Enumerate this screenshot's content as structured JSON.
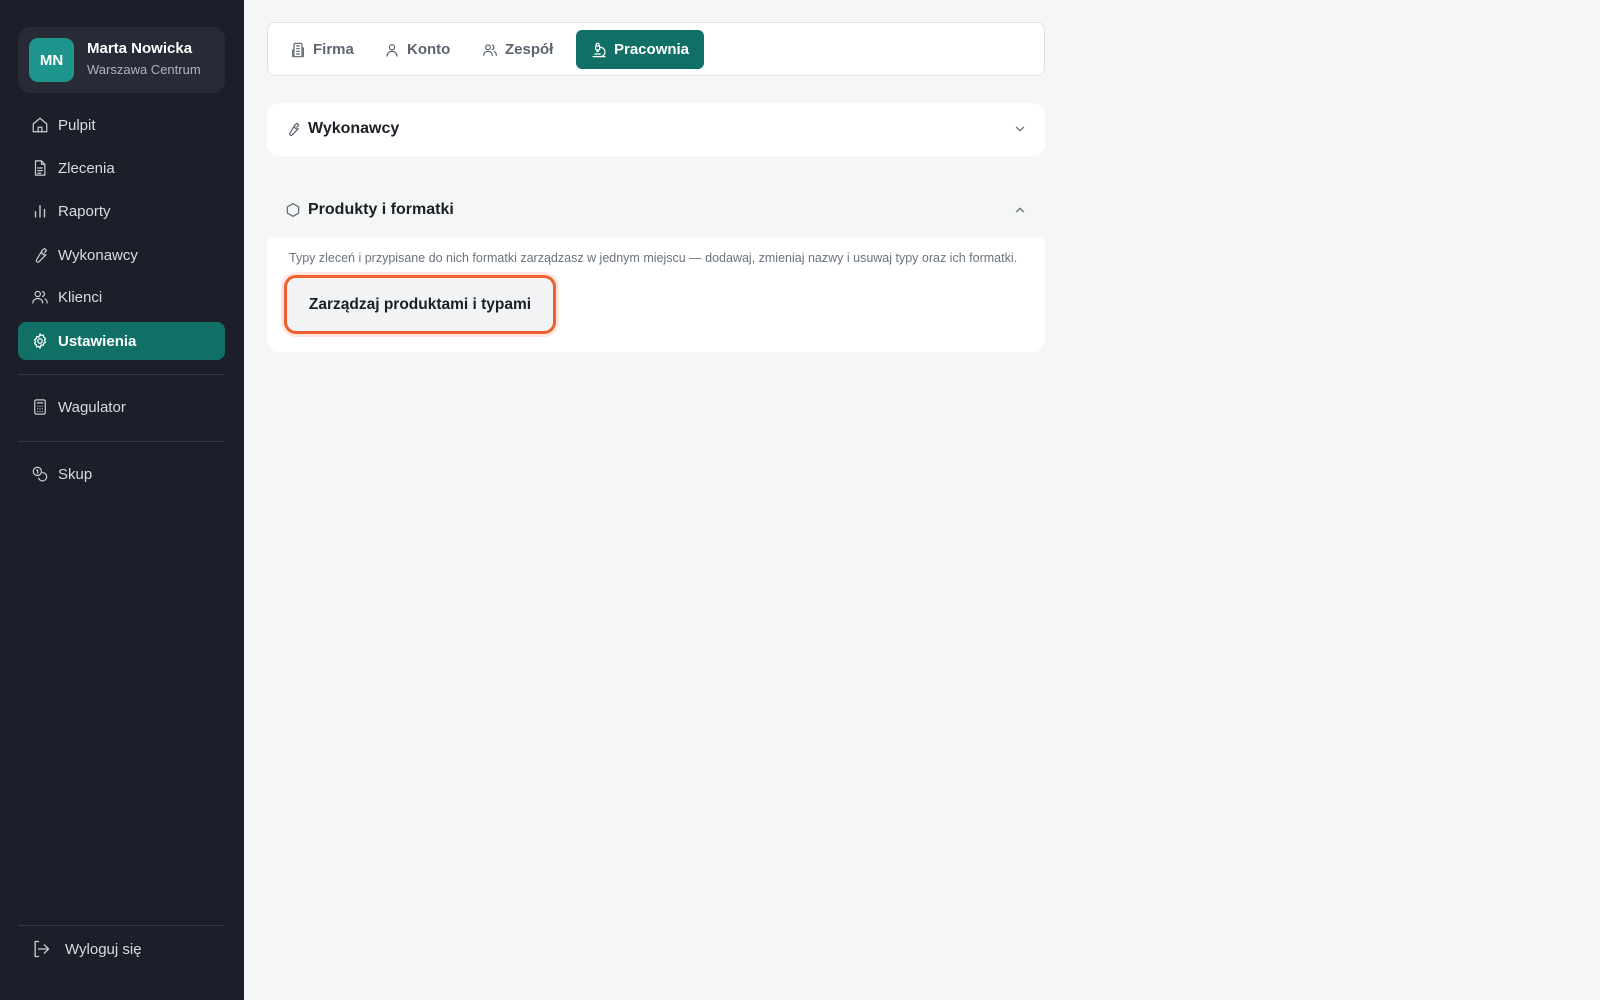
{
  "user": {
    "initials": "MN",
    "name": "Marta Nowicka",
    "branch": "Warszawa Centrum"
  },
  "sidebar": {
    "items": [
      {
        "label": "Pulpit",
        "icon": "home-icon"
      },
      {
        "label": "Zlecenia",
        "icon": "document-icon"
      },
      {
        "label": "Raporty",
        "icon": "bar-chart-icon"
      },
      {
        "label": "Wykonawcy",
        "icon": "wrench-icon"
      },
      {
        "label": "Klienci",
        "icon": "users-icon"
      },
      {
        "label": "Ustawienia",
        "icon": "gear-icon",
        "active": true
      },
      {
        "label": "Wagulator",
        "icon": "calculator-icon"
      },
      {
        "label": "Skup",
        "icon": "coins-icon"
      }
    ],
    "logout_label": "Wyloguj się"
  },
  "tabs": [
    {
      "label": "Firma",
      "icon": "building-icon"
    },
    {
      "label": "Konto",
      "icon": "user-icon"
    },
    {
      "label": "Zespół",
      "icon": "users-icon"
    },
    {
      "label": "Pracownia",
      "icon": "microscope-icon",
      "active": true
    }
  ],
  "sections": {
    "contractors": {
      "title": "Wykonawcy",
      "icon": "wrench-icon",
      "state": "collapsed"
    },
    "products": {
      "title": "Produkty i formatki",
      "icon": "hexagon-icon",
      "state": "expanded",
      "description": "Typy zleceń i przypisane do nich formatki zarządzasz w jednym miejscu — dodawaj, zmieniaj nazwy i usuwaj typy oraz ich formatki.",
      "button_label": "Zarządzaj produktami i typami"
    }
  },
  "colors": {
    "sidebar_bg": "#1c1f29",
    "accent": "#117065",
    "highlight": "#ee5e2e"
  }
}
